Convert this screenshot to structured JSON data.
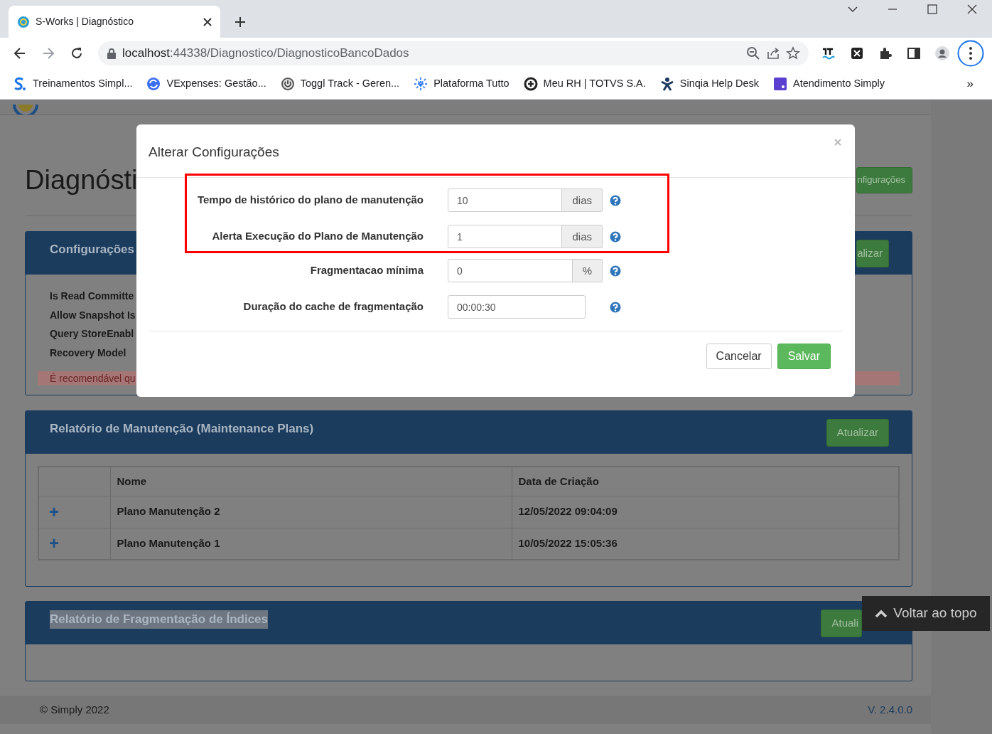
{
  "browser": {
    "tab_title": "S-Works | Diagnóstico",
    "url_host": "localhost",
    "url_path": ":44338/Diagnostico/DiagnosticoBancoDados",
    "bookmarks": [
      {
        "label": "Treinamentos Simpl...",
        "kind": "letter"
      },
      {
        "label": "VExpenses: Gestão...",
        "kind": "sync"
      },
      {
        "label": "Toggl Track - Geren...",
        "kind": "power"
      },
      {
        "label": "Plataforma Tutto",
        "kind": "network"
      },
      {
        "label": "Meu RH | TOTVS S.A.",
        "kind": "ring"
      },
      {
        "label": "Sinqia Help Desk",
        "kind": "figure"
      },
      {
        "label": "Atendimento Simply",
        "kind": "square"
      }
    ],
    "bookmarks_overflow": "»"
  },
  "page": {
    "title": "Diagnósti",
    "header_button": "nfigurações",
    "config_panel": {
      "title": "Configurações",
      "button": "alizar",
      "items": [
        "Is Read Committe",
        "Allow Snapshot Is",
        "Query StoreEnabl",
        "Recovery Model"
      ],
      "alert": "É recomendável qu"
    },
    "maintenance_panel": {
      "title": "Relatório de Manutenção (Maintenance Plans)",
      "button": "Atualizar",
      "columns": [
        "",
        "Nome",
        "Data de Criação"
      ],
      "rows": [
        {
          "expand": "+",
          "name": "Plano Manutenção 2",
          "date": "12/05/2022 09:04:09"
        },
        {
          "expand": "+",
          "name": "Plano Manutenção 1",
          "date": "10/05/2022 15:05:36"
        }
      ]
    },
    "fragmentation_panel": {
      "title": "Relatório de Fragmentação de Índices",
      "title_selected": true,
      "button": "Atuali"
    },
    "footer": {
      "copyright": "© Simply 2022",
      "version": "V. 2.4.0.0"
    },
    "back_to_top": "Voltar ao topo"
  },
  "modal": {
    "title": "Alterar Configurações",
    "fields": [
      {
        "label": "Tempo de histórico do plano de manutenção",
        "value": "10",
        "addon": "dias",
        "highlighted": true
      },
      {
        "label": "Alerta Execução do Plano de Manutenção",
        "value": "1",
        "addon": "dias",
        "highlighted": true
      },
      {
        "label": "Fragmentacao mínima",
        "value": "0",
        "addon": "%",
        "highlighted": false
      },
      {
        "label": "Duração do cache de fragmentação",
        "value": "00:00:30",
        "highlighted": false
      }
    ],
    "buttons": {
      "cancel": "Cancelar",
      "save": "Salvar"
    }
  }
}
